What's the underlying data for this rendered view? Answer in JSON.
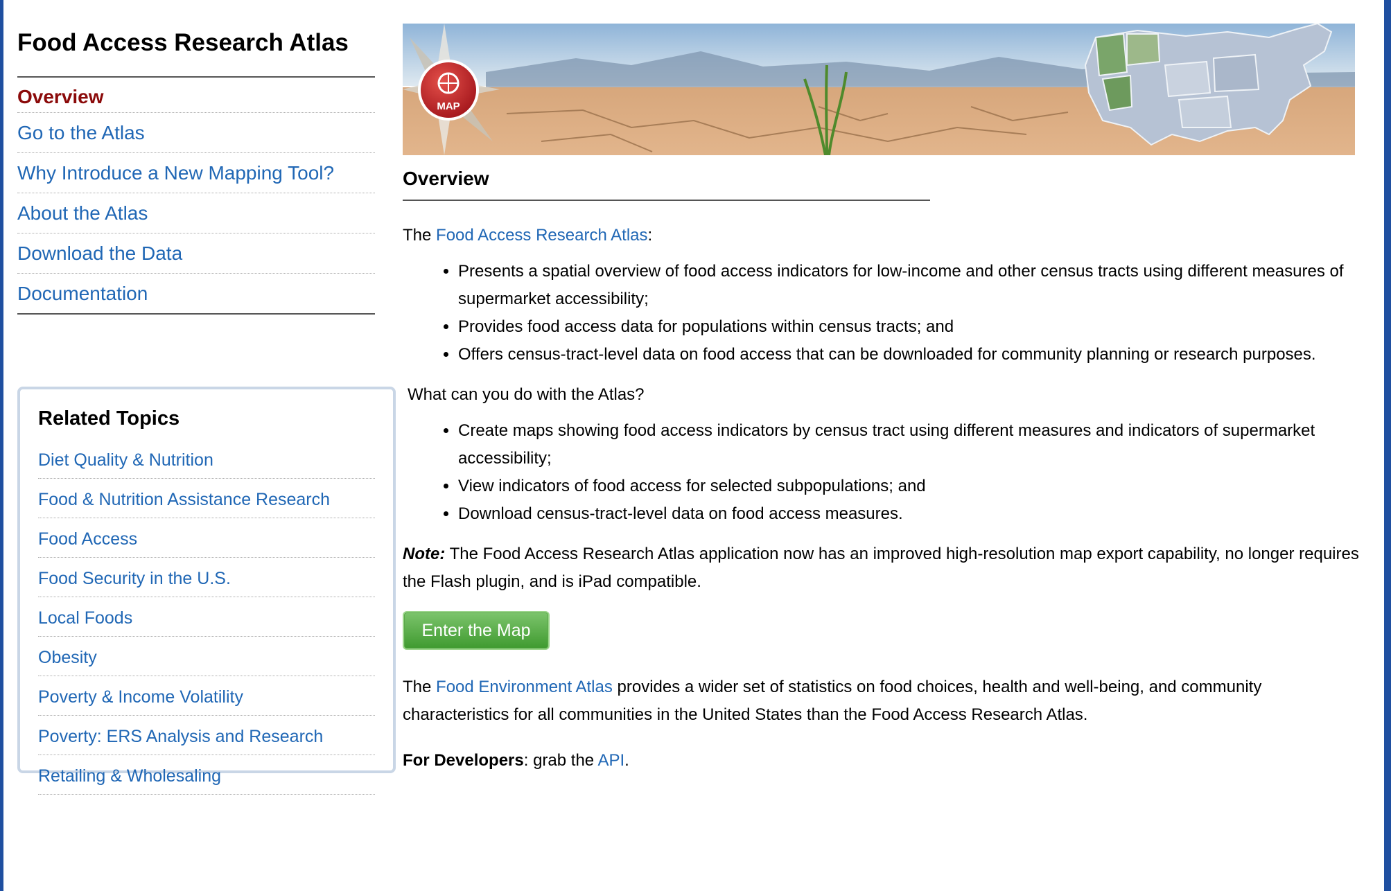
{
  "sidebar": {
    "title": "Food Access Research Atlas",
    "nav": [
      {
        "label": "Overview"
      },
      {
        "label": "Go to the Atlas"
      },
      {
        "label": "Why Introduce a New Mapping Tool?"
      },
      {
        "label": "About the Atlas"
      },
      {
        "label": "Download the Data"
      },
      {
        "label": "Documentation"
      }
    ],
    "related": {
      "heading": "Related Topics",
      "items": [
        "Diet Quality & Nutrition",
        "Food & Nutrition Assistance Research",
        "Food Access",
        "Food Security in the U.S.",
        "Local Foods",
        "Obesity",
        "Poverty & Income Volatility",
        "Poverty: ERS Analysis and Research",
        "Retailing & Wholesaling"
      ]
    }
  },
  "banner": {
    "badge_label": "MAP"
  },
  "main": {
    "heading": "Overview",
    "intro_prefix": "The ",
    "intro_link": "Food Access Research Atlas",
    "intro_suffix": ":",
    "list1": [
      "Presents a spatial overview of food access indicators for low-income and other census tracts using different measures of supermarket accessibility;",
      "Provides food access data for populations within census tracts; and",
      "Offers census-tract-level data on food access that can be downloaded for community planning or research purposes."
    ],
    "question": "What can you do with the Atlas?",
    "list2": [
      "Create maps showing food access indicators by census tract using different measures and indicators of supermarket accessibility;",
      "View indicators of food access for selected subpopulations; and",
      "Download census-tract-level data on food access measures."
    ],
    "note_label": "Note:",
    "note_text": " The Food Access Research Atlas application now has an improved high-resolution map export capability, no longer requires the Flash plugin, and is iPad compatible.",
    "button_label": "Enter the Map",
    "env_prefix": "The ",
    "env_link": "Food Environment Atlas",
    "env_text": " provides a wider set of statistics on food choices, health and well-being, and community characteristics for all communities in the United States than the Food Access Research Atlas.",
    "dev_label": "For Developers",
    "dev_text": ": grab the ",
    "dev_link": "API",
    "dev_end": "."
  },
  "colors": {
    "link": "#2067b5",
    "active": "#8b0a0a",
    "frame": "#1f4fa0",
    "button": "#4fa83e"
  }
}
